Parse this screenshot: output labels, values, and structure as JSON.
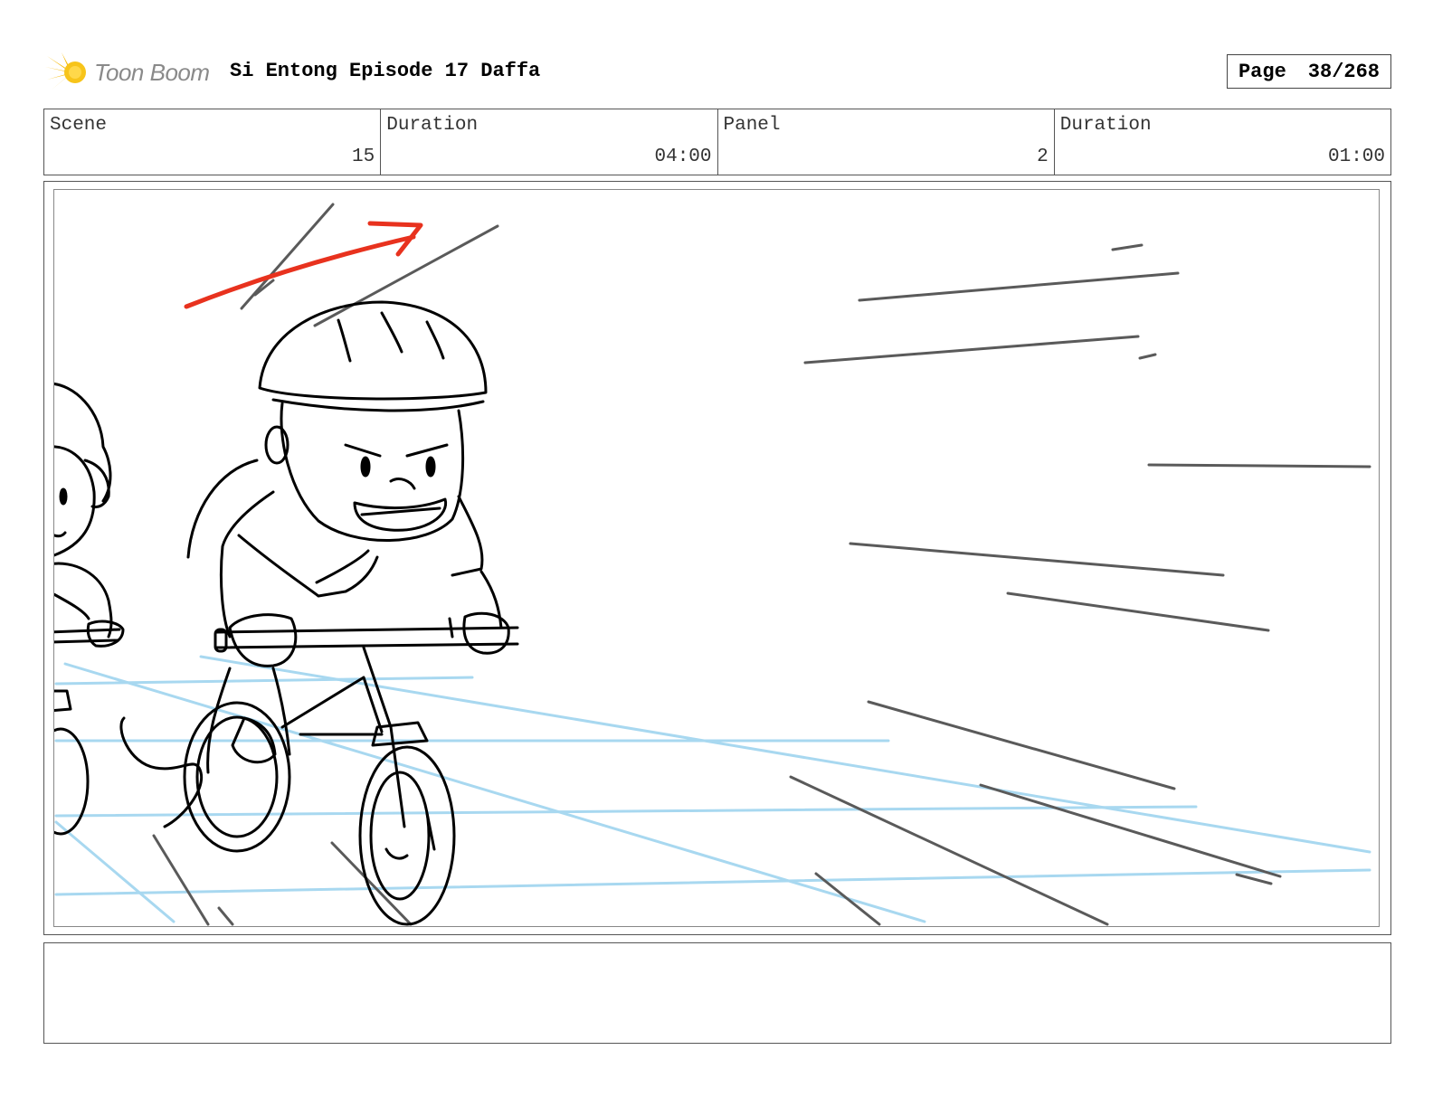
{
  "header": {
    "logo_text": "Toon Boom",
    "title": "Si Entong Episode 17 Daffa",
    "page_label": "Page",
    "page_value": "38/268"
  },
  "info": {
    "scene_label": "Scene",
    "scene_value": "15",
    "scene_duration_label": "Duration",
    "scene_duration_value": "04:00",
    "panel_label": "Panel",
    "panel_value": "2",
    "panel_duration_label": "Duration",
    "panel_duration_value": "01:00"
  },
  "colors": {
    "logo_accent": "#f5b800",
    "camera_arrow": "#e8321e",
    "guide_lines": "#a8d8f0",
    "speed_lines": "#5a5a5a"
  },
  "notes": {
    "text": ""
  }
}
